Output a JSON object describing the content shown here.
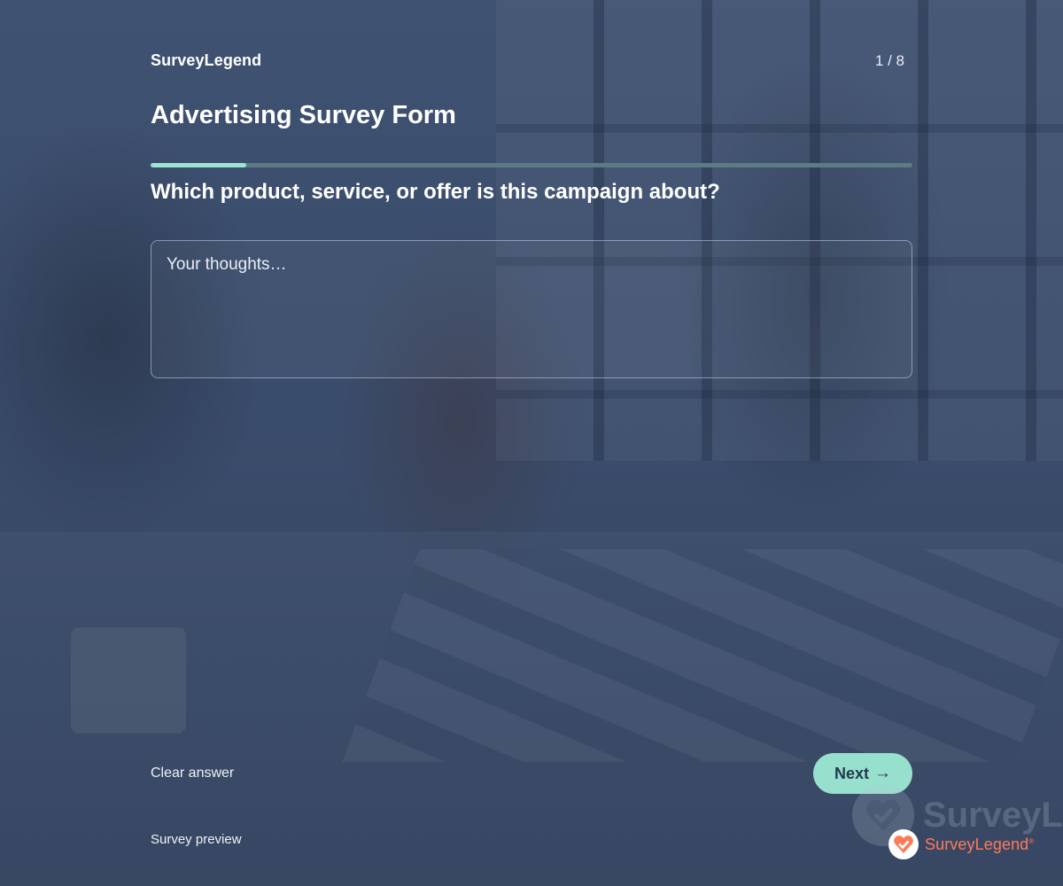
{
  "brand": {
    "name": "SurveyLegend"
  },
  "progress": {
    "page_label": "1 / 8",
    "fraction": 0.125,
    "fill_color": "#9fe3d3",
    "track_color": "#5d7b86"
  },
  "survey": {
    "title": "Advertising Survey Form",
    "question": "Which product, service, or offer is this campaign about?",
    "answer_value": "",
    "answer_placeholder": "Your thoughts…"
  },
  "actions": {
    "clear_label": "Clear answer",
    "next_label": "Next",
    "next_icon": "arrow-right-icon",
    "next_color": "#97e0cd"
  },
  "footer": {
    "preview_label": "Survey preview",
    "logo_text": "SurveyLegend",
    "logo_mark": "®",
    "logo_color": "#ff7a59",
    "watermark_text": "SurveyL"
  }
}
